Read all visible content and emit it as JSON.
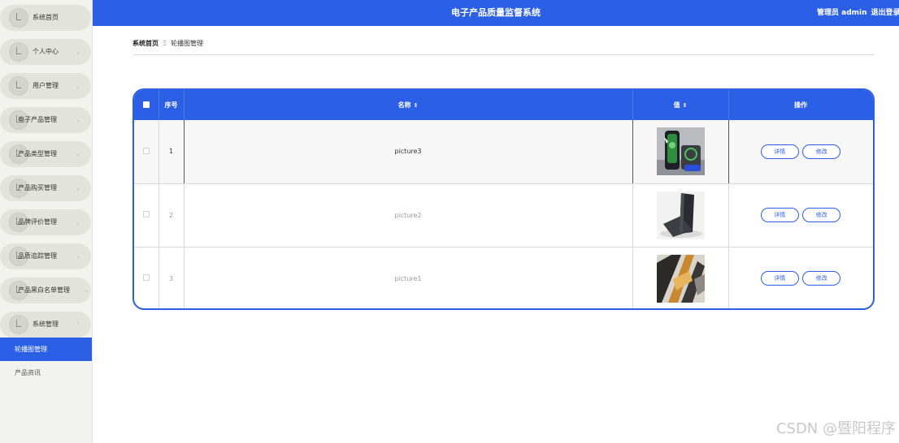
{
  "app": {
    "title": "电子产品质量监督系统",
    "user_label": "管理员 admin",
    "logout_label": "退出登录"
  },
  "sidebar": {
    "items": [
      {
        "label": "系统首页",
        "chevron": ""
      },
      {
        "label": "个人中心",
        "chevron": "⌄"
      },
      {
        "label": "用户管理",
        "chevron": "⌄"
      },
      {
        "label": "电子产品管理",
        "chevron": "⌄"
      },
      {
        "label": "产品类型管理",
        "chevron": "⌄"
      },
      {
        "label": "产品购买管理",
        "chevron": "⌄"
      },
      {
        "label": "品牌评价管理",
        "chevron": "⌄"
      },
      {
        "label": "品质追踪管理",
        "chevron": "⌄"
      },
      {
        "label": "产品黑白名单管理",
        "chevron": "⌄"
      },
      {
        "label": "系统管理",
        "chevron": "⌃"
      }
    ],
    "sub_items": [
      {
        "label": "轮播图管理",
        "active": true
      },
      {
        "label": "产品资讯",
        "active": false
      }
    ]
  },
  "breadcrumb": {
    "home": "系统首页",
    "separator": "Ξ",
    "current": "轮播图管理"
  },
  "table": {
    "headers": {
      "index": "序号",
      "name": "名称",
      "value": "值",
      "actions": "操作",
      "sort_icon": "⇕"
    },
    "rows": [
      {
        "index": "1",
        "name": "picture3",
        "image": "wireless-charger-photo"
      },
      {
        "index": "2",
        "name": "picture2",
        "image": "phone-stand-photo"
      },
      {
        "index": "3",
        "name": "picture1",
        "image": "gadget-closeup-photo"
      }
    ],
    "detail_label": "详情",
    "edit_label": "修改"
  },
  "colors": {
    "primary": "#2a5fe6",
    "sidebar_bg": "#f2f2ee",
    "nav_pill": "#e3e3dd"
  },
  "watermark": "CSDN @暨阳程序"
}
